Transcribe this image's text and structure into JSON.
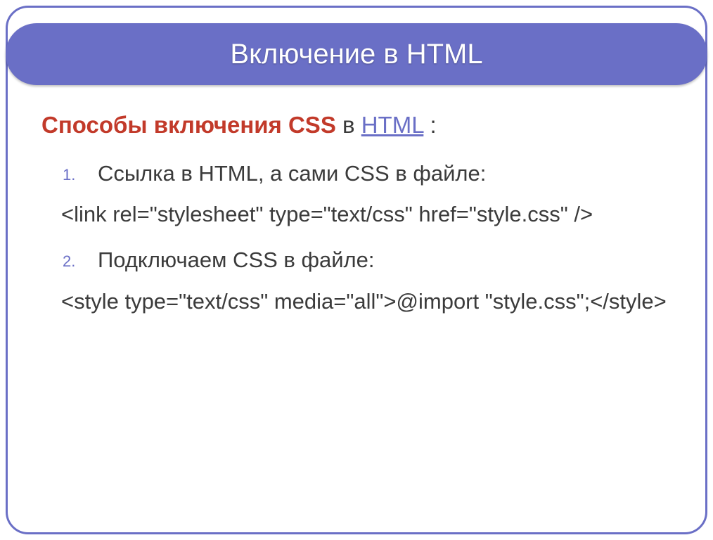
{
  "title": "Включение в HTML",
  "heading": {
    "red_part": "Способы включения CSS",
    "middle": " в ",
    "link": "HTML",
    "tail": " :"
  },
  "items": [
    {
      "text": "Ссылка в HTML, а сами CSS в файле:",
      "code": "<link rel=\"stylesheet\" type=\"text/css\" href=\"style.css\" />"
    },
    {
      "text": "Подключаем CSS в файле:",
      "code": "<style type=\"text/css\" media=\"all\">@import \"style.css\";</style>"
    }
  ]
}
